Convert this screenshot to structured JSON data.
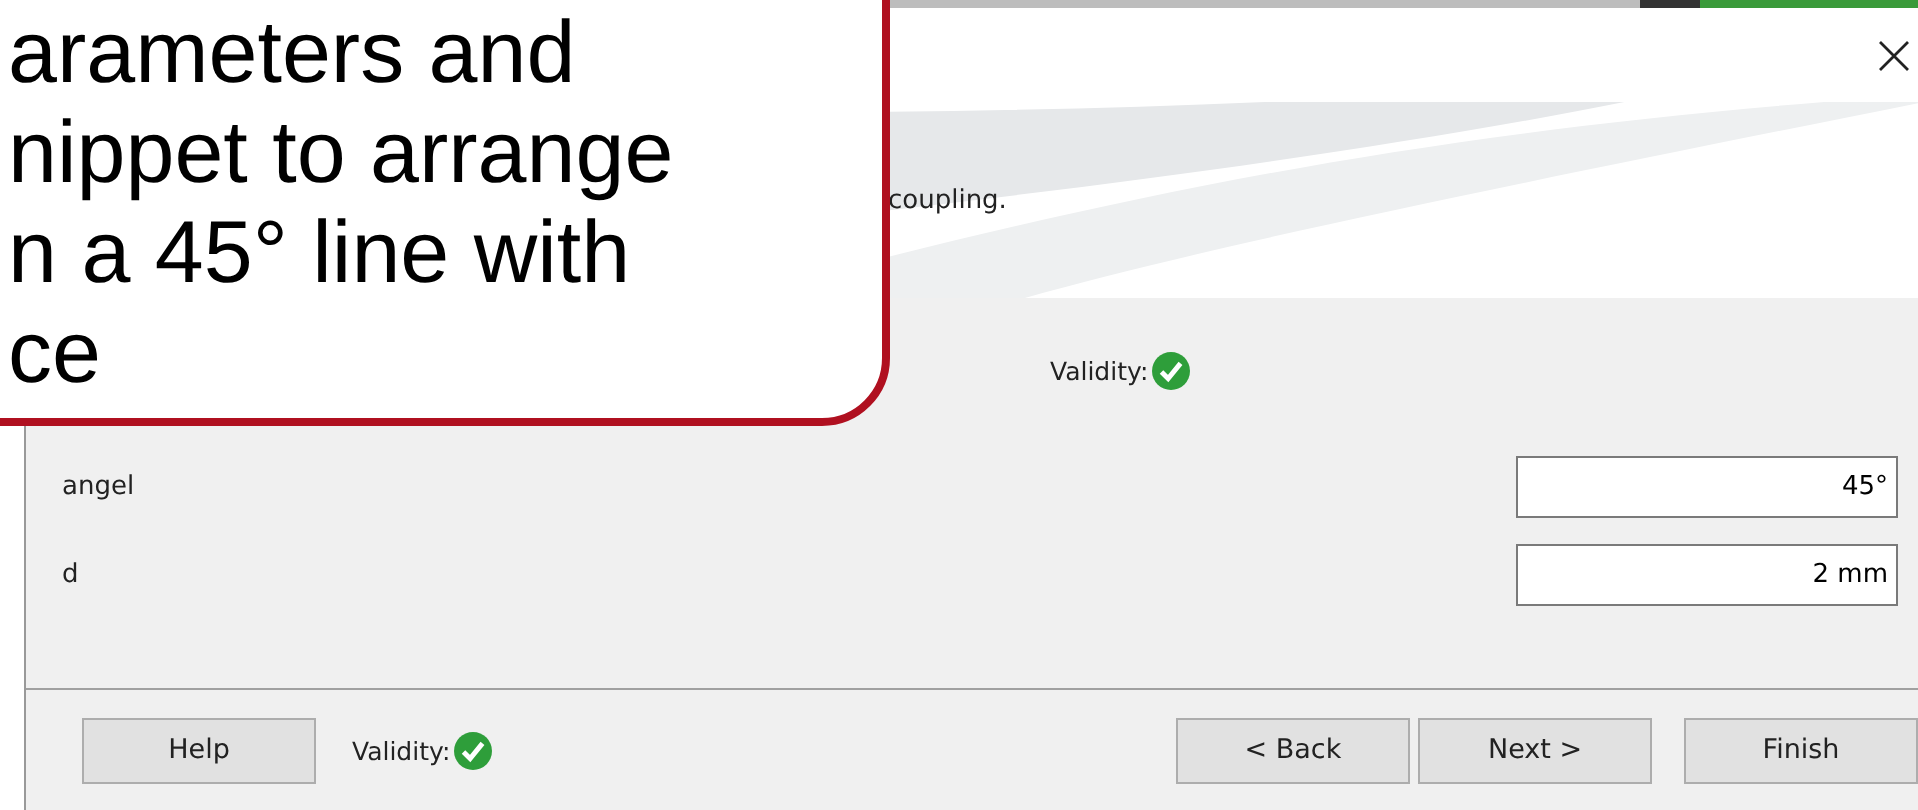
{
  "dialog": {
    "header": {
      "description": "coupling."
    },
    "validity": {
      "label": "Validity:",
      "valid": true
    },
    "parameters": [
      {
        "name": "angel",
        "value": "45°"
      },
      {
        "name": "d",
        "value": "2 mm"
      }
    ],
    "footer": {
      "help": "Help",
      "validity": {
        "label": "Validity:",
        "valid": true
      },
      "buttons": [
        "< Back",
        "Next >",
        "Finish"
      ]
    }
  },
  "callout": {
    "lines": [
      "arameters and",
      "nippet to arrange",
      "n a 45° line with",
      "ce"
    ]
  }
}
